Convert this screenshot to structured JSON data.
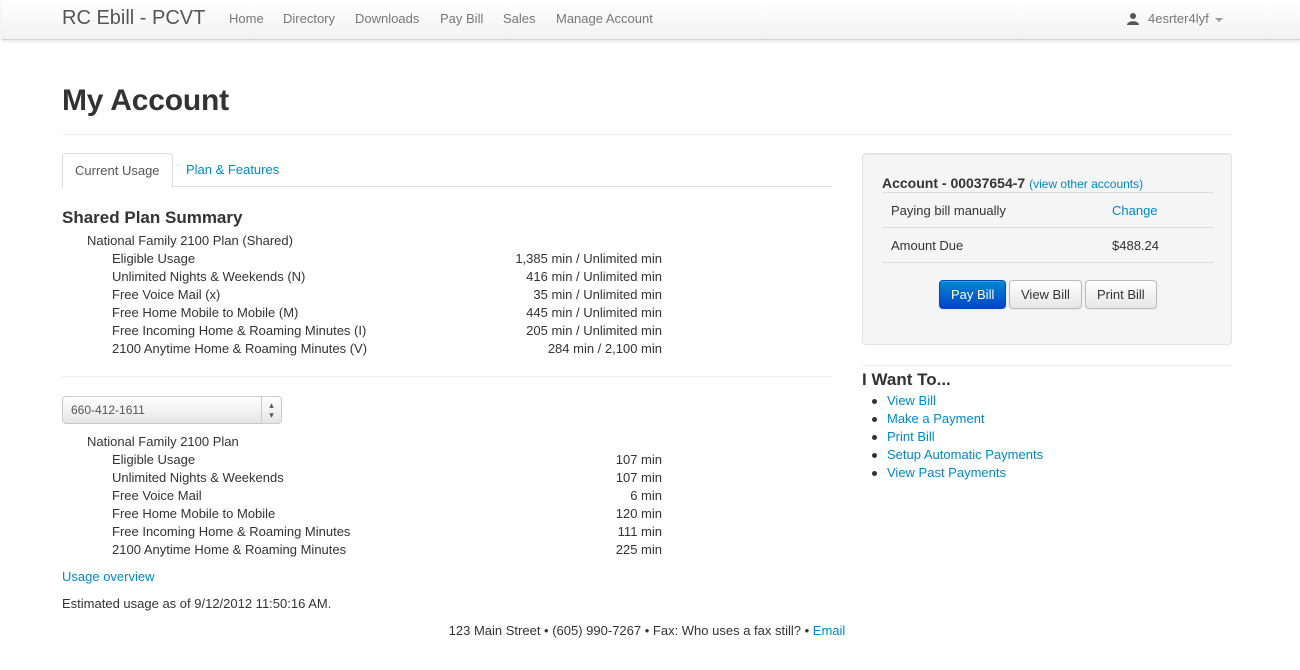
{
  "navbar": {
    "brand": "RC Ebill - PCVT",
    "items": [
      {
        "label": "Home"
      },
      {
        "label": "Directory"
      },
      {
        "label": "Downloads"
      },
      {
        "label": "Pay Bill"
      },
      {
        "label": "Sales"
      },
      {
        "label": "Manage Account"
      }
    ],
    "user": {
      "name": "4esrter4lyf",
      "icon": "user-icon"
    }
  },
  "page": {
    "title": "My Account"
  },
  "tabs": [
    {
      "label": "Current Usage",
      "active": true
    },
    {
      "label": "Plan & Features",
      "active": false
    }
  ],
  "shared_summary": {
    "title": "Shared Plan Summary",
    "plan_name": "National Family 2100 Plan (Shared)",
    "rows": [
      {
        "label": "Eligible Usage",
        "value": "1,385 min / Unlimited min"
      },
      {
        "label": "Unlimited Nights & Weekends (N)",
        "value": "416 min / Unlimited min"
      },
      {
        "label": "Free Voice Mail (x)",
        "value": "35 min / Unlimited min"
      },
      {
        "label": "Free Home Mobile to Mobile (M)",
        "value": "445 min / Unlimited min"
      },
      {
        "label": "Free Incoming Home & Roaming Minutes (I)",
        "value": "205 min / Unlimited min"
      },
      {
        "label": "2100 Anytime Home & Roaming Minutes (V)",
        "value": "284 min / 2,100 min"
      }
    ]
  },
  "line": {
    "selected_number": "660-412-1611",
    "plan_name": "National Family 2100 Plan",
    "rows": [
      {
        "label": "Eligible Usage",
        "value": "107 min"
      },
      {
        "label": "Unlimited Nights & Weekends",
        "value": "107 min"
      },
      {
        "label": "Free Voice Mail",
        "value": "6 min"
      },
      {
        "label": "Free Home Mobile to Mobile",
        "value": "120 min"
      },
      {
        "label": "Free Incoming Home & Roaming Minutes",
        "value": "111 min"
      },
      {
        "label": "2100 Anytime Home & Roaming Minutes",
        "value": "225 min"
      }
    ],
    "overview_link": "Usage overview",
    "estimate_text": "Estimated usage as of 9/12/2012 11:50:16 AM."
  },
  "account": {
    "heading": "Account - 00037654-7",
    "view_other": "(view other accounts)",
    "rows": [
      {
        "label": "Paying bill manually",
        "value": "Change",
        "value_is_link": true
      },
      {
        "label": "Amount Due",
        "value": "$488.24",
        "value_is_link": false
      }
    ],
    "buttons": {
      "pay": "Pay Bill",
      "view": "View Bill",
      "print": "Print Bill"
    }
  },
  "i_want_to": {
    "title": "I Want To...",
    "links": [
      "View Bill",
      "Make a Payment",
      "Print Bill",
      "Setup Automatic Payments",
      "View Past Payments"
    ]
  },
  "footer": {
    "text": "123 Main Street • (605) 990-7267 • Fax: Who uses a fax still? •",
    "email_link": "Email"
  },
  "colors": {
    "link": "#0088cc",
    "primary_button": "#0055cc"
  }
}
